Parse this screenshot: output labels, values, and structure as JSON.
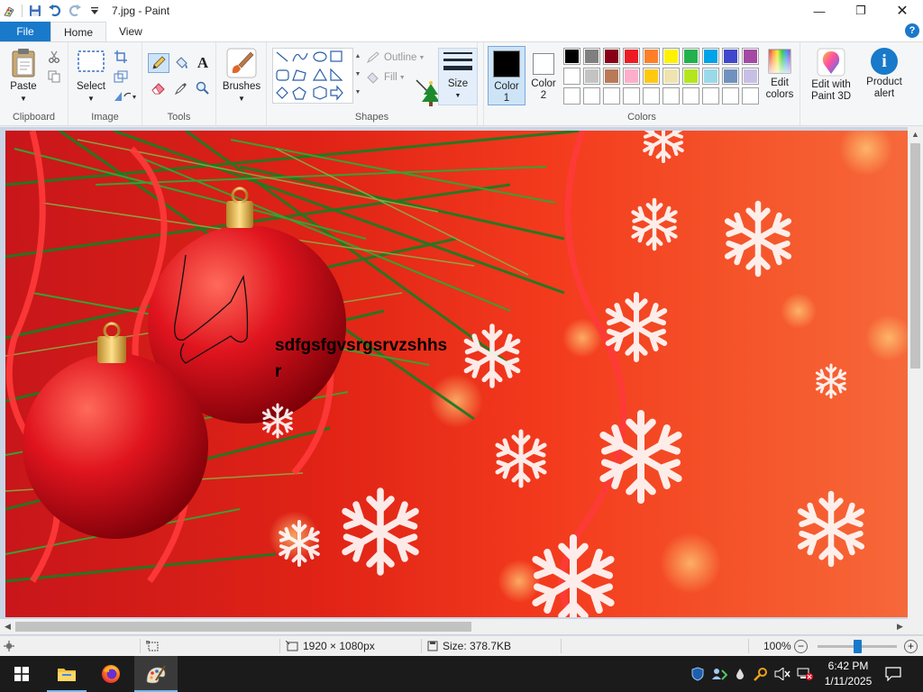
{
  "window": {
    "title": "7.jpg - Paint",
    "minimize_glyph": "—",
    "maximize_glyph": "❐",
    "close_glyph": "✕"
  },
  "tabs": {
    "file": "File",
    "home": "Home",
    "view": "View",
    "help_glyph": "?"
  },
  "ribbon": {
    "clipboard": {
      "paste_label": "Paste",
      "group_label": "Clipboard"
    },
    "image": {
      "select_label": "Select",
      "group_label": "Image"
    },
    "tools": {
      "group_label": "Tools",
      "text_tool_glyph": "A"
    },
    "brushes": {
      "label": "Brushes"
    },
    "shapes": {
      "outline_label": "Outline",
      "fill_label": "Fill",
      "group_label": "Shapes"
    },
    "size": {
      "label": "Size"
    },
    "color1": {
      "label_line1": "Color",
      "label_line2": "1",
      "color": "#000000"
    },
    "color2": {
      "label_line1": "Color",
      "label_line2": "2",
      "color": "#ffffff"
    },
    "palette": {
      "row1": [
        "#000000",
        "#7f7f7f",
        "#880015",
        "#ed1c24",
        "#ff7f27",
        "#fff200",
        "#22b14c",
        "#00a2e8",
        "#3f48cc",
        "#a349a4"
      ],
      "row2": [
        "#ffffff",
        "#c3c3c3",
        "#b97a57",
        "#ffaec9",
        "#ffc90e",
        "#efe4b0",
        "#b5e61d",
        "#99d9ea",
        "#7092be",
        "#c8bfe7"
      ],
      "row3": [
        "#ffffff",
        "#ffffff",
        "#ffffff",
        "#ffffff",
        "#ffffff",
        "#ffffff",
        "#ffffff",
        "#ffffff",
        "#ffffff",
        "#ffffff"
      ]
    },
    "colors_group_label": "Colors",
    "edit_colors": {
      "line1": "Edit",
      "line2": "colors"
    },
    "edit_paint3d": {
      "line1": "Edit with",
      "line2": "Paint 3D"
    },
    "product_alert": {
      "line1": "Product",
      "line2": "alert",
      "glyph": "i"
    }
  },
  "canvas": {
    "text_line1": "sdfgsfgvsrgsrvzshhs",
    "text_line2": "r"
  },
  "statusbar": {
    "dimensions": "1920 × 1080px",
    "size": "Size: 378.7KB",
    "zoom": "100%",
    "zoom_level": 0.5,
    "zoom_out_glyph": "−",
    "zoom_in_glyph": "+"
  },
  "taskbar": {
    "time": "6:42 PM",
    "date": "1/11/2025",
    "apps": [
      "file-explorer",
      "firefox",
      "paint"
    ]
  },
  "accent_color": "#1979ca"
}
